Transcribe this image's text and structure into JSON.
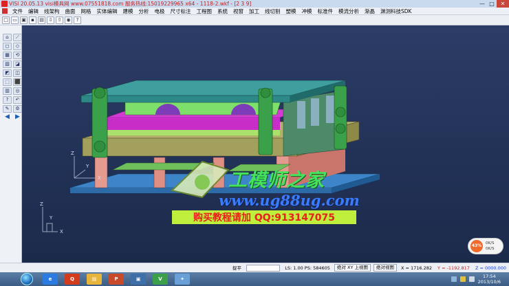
{
  "window": {
    "title": "VISI 20.05.13 visi模具网 www.07551818.com 服务热线:15019229965 x64 - 1118-2.wkf - [2 3 9]",
    "minimize": "—",
    "maximize": "□",
    "close": "✕"
  },
  "menu": {
    "items": [
      "文件",
      "编辑",
      "线架构",
      "曲面",
      "网格",
      "实体编辑",
      "建模",
      "分析",
      "电极",
      "尺寸标注",
      "工程图",
      "系统",
      "视窗",
      "加工",
      "线切割",
      "塑模",
      "冲模",
      "标准件",
      "模流分析",
      "渐晶",
      "渊测科技SDK"
    ]
  },
  "toolbar": {
    "buttons": [
      {
        "name": "new",
        "glyph": "□"
      },
      {
        "name": "open",
        "glyph": "▭"
      },
      {
        "name": "save-as",
        "glyph": "▣"
      },
      {
        "name": "save",
        "glyph": "▪"
      },
      {
        "name": "print",
        "glyph": "▤"
      },
      {
        "name": "import",
        "glyph": "⇩"
      },
      {
        "name": "export",
        "glyph": "⇧"
      },
      {
        "name": "web",
        "glyph": "◉"
      },
      {
        "name": "help",
        "glyph": "?"
      }
    ]
  },
  "left_tools": [
    "⌂",
    "⟋",
    "◻",
    "◇",
    "▦",
    "⟲",
    "▧",
    "◪",
    "◩",
    "◫",
    "⬚",
    "⬛",
    "▥",
    "◎",
    "?",
    "↶",
    "✎",
    "⚙",
    "◀",
    "▶"
  ],
  "viewport": {
    "axis_labels": {
      "z": "Z",
      "y": "Y",
      "x": "X"
    },
    "axis_labels_small": {
      "z": "Z",
      "y": "Y",
      "x": "X"
    }
  },
  "watermark": {
    "site_name": "工模师之家",
    "url": "www.ug88ug.com",
    "ad": "购买教程请加 QQ:913147075"
  },
  "speed_badge": {
    "percent": "43%",
    "up": "0K/S",
    "down": "0K/S"
  },
  "status": {
    "mode": "捉平",
    "ls_ps": "LS: 1.00 PS: 584605",
    "view1": "绝对 XY 上视图",
    "view2": "绝对视图",
    "x": "X = 1716.282",
    "y": "Y = -1192.817",
    "z": "Z = 0000.000"
  },
  "taskbar": {
    "apps": [
      {
        "name": "ie",
        "label": "e",
        "color": "#2b7be0"
      },
      {
        "name": "qq",
        "label": "Q",
        "color": "#d23c1c"
      },
      {
        "name": "explorer",
        "label": "▤",
        "color": "#e7b43c"
      },
      {
        "name": "ppt",
        "label": "P",
        "color": "#c84a2a"
      },
      {
        "name": "display",
        "label": "▣",
        "color": "#3f6fa8"
      },
      {
        "name": "visi",
        "label": "V",
        "color": "#3ca04a"
      },
      {
        "name": "tool",
        "label": "✦",
        "color": "#6aa0d8"
      }
    ],
    "clock_time": "17:54",
    "clock_date": "2013/10/6"
  }
}
